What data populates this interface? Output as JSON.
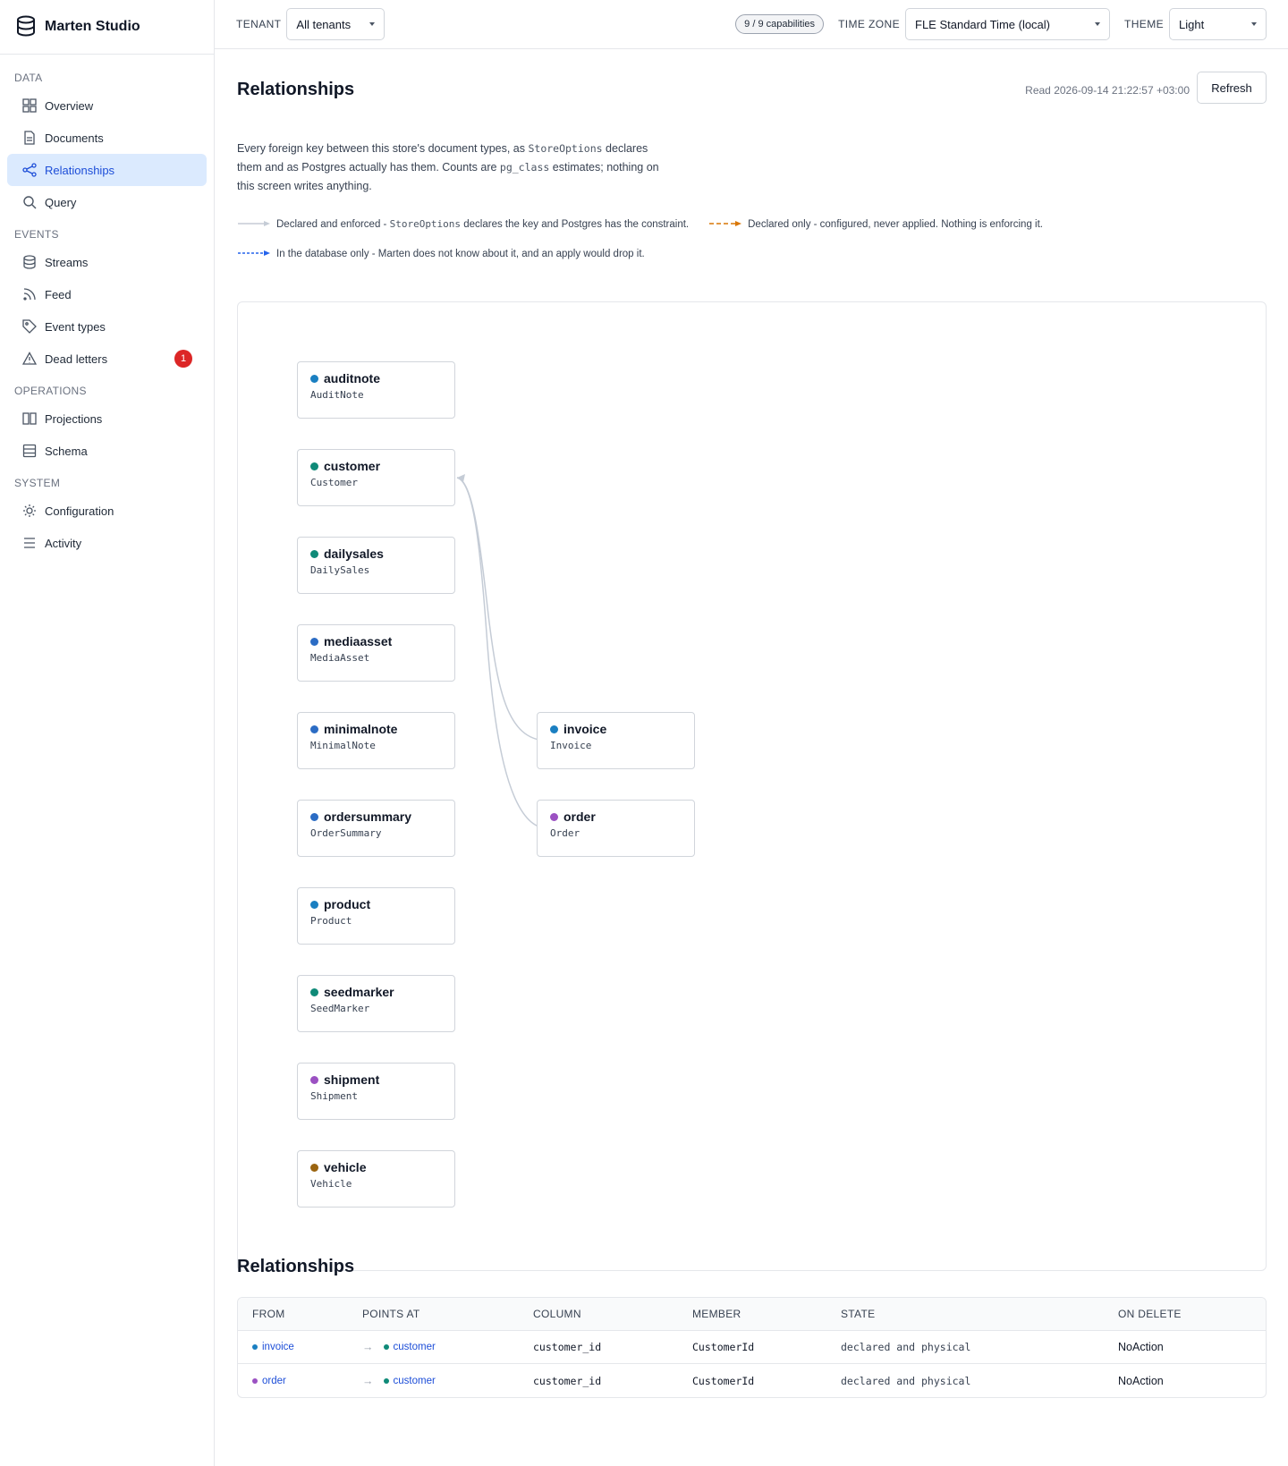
{
  "app": {
    "title": "Marten Studio"
  },
  "sidebar": {
    "sections": [
      {
        "label": "DATA",
        "items": [
          {
            "label": "Overview",
            "icon": "grid-icon"
          },
          {
            "label": "Documents",
            "icon": "document-icon"
          },
          {
            "label": "Relationships",
            "icon": "share-icon",
            "active": true
          },
          {
            "label": "Query",
            "icon": "search-icon"
          }
        ]
      },
      {
        "label": "EVENTS",
        "items": [
          {
            "label": "Streams",
            "icon": "database-icon"
          },
          {
            "label": "Feed",
            "icon": "rss-icon"
          },
          {
            "label": "Event types",
            "icon": "tag-icon"
          },
          {
            "label": "Dead letters",
            "icon": "warning-icon",
            "badge": "1"
          }
        ]
      },
      {
        "label": "OPERATIONS",
        "items": [
          {
            "label": "Projections",
            "icon": "columns-icon"
          },
          {
            "label": "Schema",
            "icon": "layers-icon"
          }
        ]
      },
      {
        "label": "SYSTEM",
        "items": [
          {
            "label": "Configuration",
            "icon": "gear-icon"
          },
          {
            "label": "Activity",
            "icon": "list-icon"
          }
        ]
      }
    ]
  },
  "topbar": {
    "tenant_label": "TENANT",
    "tenant_value": "All tenants",
    "capabilities": "9 / 9 capabilities",
    "timezone_label": "TIME ZONE",
    "timezone_value": "FLE Standard Time (local)",
    "theme_label": "THEME",
    "theme_value": "Light"
  },
  "page": {
    "title": "Relationships",
    "read_time": "Read 2026-09-14 21:22:57 +03:00",
    "refresh_label": "Refresh",
    "intro": {
      "p1": "Every foreign key between this store's document types, as ",
      "code1": "StoreOptions",
      "p2": " declares them and as Postgres actually has them. Counts are ",
      "code2": "pg_class",
      "p3": " estimates; nothing on this screen writes anything."
    },
    "legend": {
      "enforced_a": "Declared and enforced - ",
      "enforced_code": "StoreOptions",
      "enforced_b": " declares the key and Postgres has the constraint.",
      "declared_only": "Declared only - configured, never applied. Nothing is enforcing it.",
      "db_only": "In the database only - Marten does not know about it, and an apply would drop it."
    }
  },
  "colors": {
    "teal": "#0f8a78",
    "blue": "#2b6cc4",
    "sky": "#1a7fc1",
    "purple": "#9b51c2",
    "brown": "#9a6410",
    "edge": "#c5ccd6",
    "declared": "#d97706",
    "dbonly": "#2563eb"
  },
  "graph": {
    "nodes": [
      {
        "name": "auditnote",
        "type": "AuditNote",
        "color": "#1a7fc1"
      },
      {
        "name": "customer",
        "type": "Customer",
        "color": "#0f8a78"
      },
      {
        "name": "dailysales",
        "type": "DailySales",
        "color": "#0f8a78"
      },
      {
        "name": "mediaasset",
        "type": "MediaAsset",
        "color": "#2b6cc4"
      },
      {
        "name": "minimalnote",
        "type": "MinimalNote",
        "color": "#2b6cc4"
      },
      {
        "name": "ordersummary",
        "type": "OrderSummary",
        "color": "#2b6cc4"
      },
      {
        "name": "product",
        "type": "Product",
        "color": "#1a7fc1"
      },
      {
        "name": "seedmarker",
        "type": "SeedMarker",
        "color": "#0f8a78"
      },
      {
        "name": "shipment",
        "type": "Shipment",
        "color": "#9b51c2"
      },
      {
        "name": "vehicle",
        "type": "Vehicle",
        "color": "#9a6410"
      },
      {
        "name": "invoice",
        "type": "Invoice",
        "color": "#1a7fc1"
      },
      {
        "name": "order",
        "type": "Order",
        "color": "#9b51c2"
      }
    ],
    "edges": [
      {
        "from": "invoice",
        "to": "customer",
        "state": "declared and physical"
      },
      {
        "from": "order",
        "to": "customer",
        "state": "declared and physical"
      }
    ]
  },
  "table": {
    "title": "Relationships",
    "headers": [
      "FROM",
      "POINTS AT",
      "COLUMN",
      "MEMBER",
      "STATE",
      "ON DELETE"
    ],
    "rows": [
      {
        "from": "invoice",
        "from_color": "#1a7fc1",
        "to": "customer",
        "to_color": "#0f8a78",
        "column": "customer_id",
        "member": "CustomerId",
        "state": "declared and physical",
        "on_delete": "NoAction"
      },
      {
        "from": "order",
        "from_color": "#9b51c2",
        "to": "customer",
        "to_color": "#0f8a78",
        "column": "customer_id",
        "member": "CustomerId",
        "state": "declared and physical",
        "on_delete": "NoAction"
      }
    ]
  }
}
